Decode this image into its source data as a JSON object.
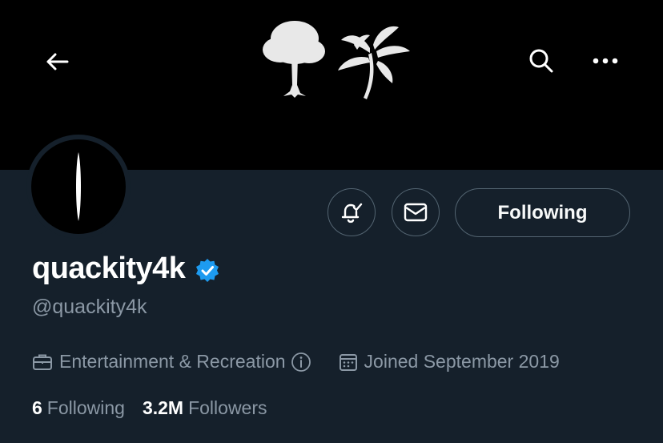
{
  "header": {
    "back_icon": "arrow-left-icon",
    "search_icon": "search-icon",
    "more_icon": "more-dots-icon"
  },
  "profile": {
    "display_name": "quackity4k",
    "handle": "@quackity4k",
    "verified": true,
    "category": "Entertainment & Recreation",
    "joined": "Joined September 2019",
    "following_count": "6",
    "following_label": "Following",
    "followers_count": "3.2M",
    "followers_label": "Followers"
  },
  "actions": {
    "notify_icon": "bell-check-icon",
    "message_icon": "envelope-icon",
    "follow_label": "Following"
  },
  "colors": {
    "background": "#15202b",
    "banner": "#000000",
    "secondary_text": "#8b98a5",
    "verified_blue": "#1d9bf0",
    "border": "#536471"
  }
}
